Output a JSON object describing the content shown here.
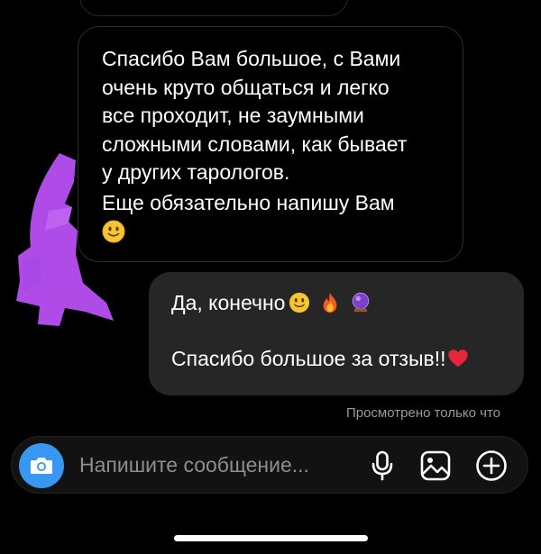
{
  "incoming_message": {
    "lines": [
      "Спасибо Вам большое, с Вами",
      "очень круто общаться и легко",
      "все проходит, не заумными",
      "сложными словами, как бывает",
      "у других тарологов.",
      "Еще обязательно напишу Вам"
    ],
    "emoji": "slightly-smiling-face"
  },
  "outgoing_message": {
    "line1": "Да, конечно",
    "line1_emojis": [
      "slightly-smiling-face",
      "fire",
      "crystal-ball"
    ],
    "line2": "Спасибо большое за отзыв!!",
    "line2_emoji": "red-heart"
  },
  "status": {
    "seen": "Просмотрено только что"
  },
  "composer": {
    "placeholder": "Напишите сообщение...",
    "icons": [
      "camera-icon",
      "microphone-icon",
      "gallery-icon",
      "plus-icon"
    ]
  },
  "colors": {
    "background": "#000000",
    "outgoing_bubble": "#262626",
    "camera_button": "#3897f0",
    "scribble": "#b64ff0",
    "placeholder": "#8e8e8e"
  }
}
